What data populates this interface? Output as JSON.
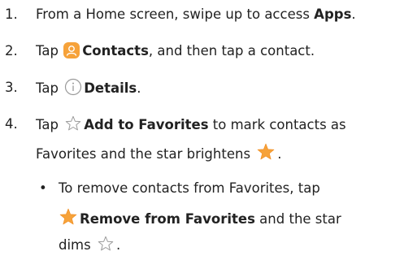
{
  "steps": [
    {
      "number": "1.",
      "before": "From a Home screen, swipe up to access ",
      "bold": "Apps",
      "after": "."
    },
    {
      "number": "2.",
      "before": "Tap ",
      "icon": "contacts-app-icon",
      "bold": "Contacts",
      "after": ", and then tap a contact."
    },
    {
      "number": "3.",
      "before": "Tap ",
      "icon": "info-circle-icon",
      "bold": "Details",
      "after": "."
    },
    {
      "number": "4.",
      "before": "Tap ",
      "icon": "star-outline-icon",
      "bold": "Add to Favorites",
      "after": " to mark contacts as",
      "line2_before": "Favorites and the star brightens ",
      "line2_icon": "star-filled-icon",
      "line2_after": "."
    }
  ],
  "sub_bullet": {
    "line1": "To remove contacts from Favorites, tap",
    "line2_icon": "star-filled-icon",
    "line2_bold": "Remove from Favorites",
    "line2_after": " and the star",
    "line3_before": "dims ",
    "line3_icon": "star-outline-icon",
    "line3_after": "."
  },
  "colors": {
    "text": "#222222",
    "accent_orange": "#f6a23a",
    "icon_gray": "#9a9a9a"
  }
}
